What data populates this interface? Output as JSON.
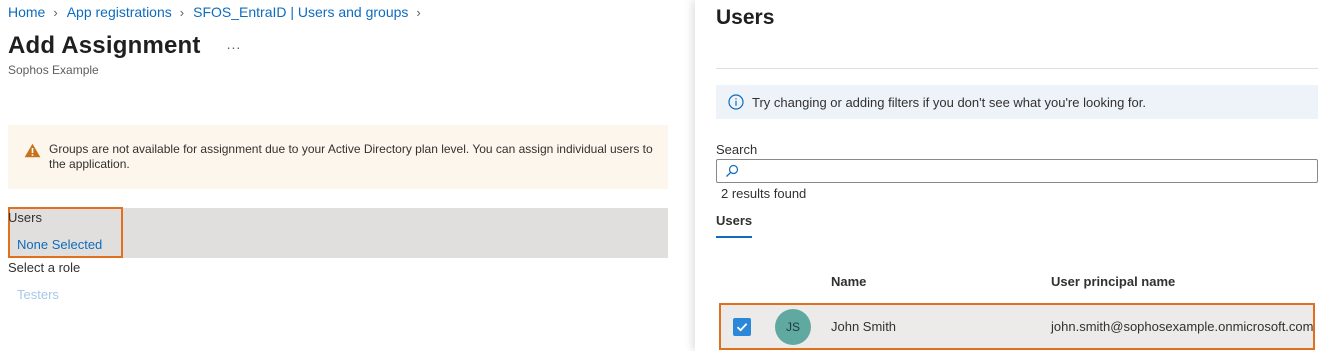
{
  "breadcrumb": [
    {
      "label": "Home"
    },
    {
      "label": "App registrations"
    },
    {
      "label": "SFOS_EntraID | Users and groups"
    }
  ],
  "page": {
    "title": "Add Assignment",
    "more_label": "...",
    "subtitle": "Sophos Example"
  },
  "warning": {
    "icon": "warning-icon",
    "line1": "Groups are not available for assignment due to your Active Directory plan level. You can assign individual users to",
    "line2": "the application."
  },
  "users_field": {
    "label": "Users",
    "value": "None Selected"
  },
  "role_field": {
    "label": "Select a role",
    "value": "Testers"
  },
  "panel": {
    "title": "Users",
    "info_text": "Try changing or adding filters if you don't see what you're looking for.",
    "search_label": "Search",
    "search_value": "",
    "results_text": "2 results found",
    "tab_label": "Users",
    "columns": {
      "name": "Name",
      "upn": "User principal name"
    },
    "rows": [
      {
        "initials": "JS",
        "name": "John Smith",
        "upn": "john.smith@sophosexample.onmicrosoft.com",
        "selected": true
      }
    ]
  },
  "colors": {
    "accent": "#0f6cbd",
    "highlight_border": "#e0701c",
    "warning_bg": "#fdf6ec",
    "avatar_bg": "#5fa9a0"
  }
}
